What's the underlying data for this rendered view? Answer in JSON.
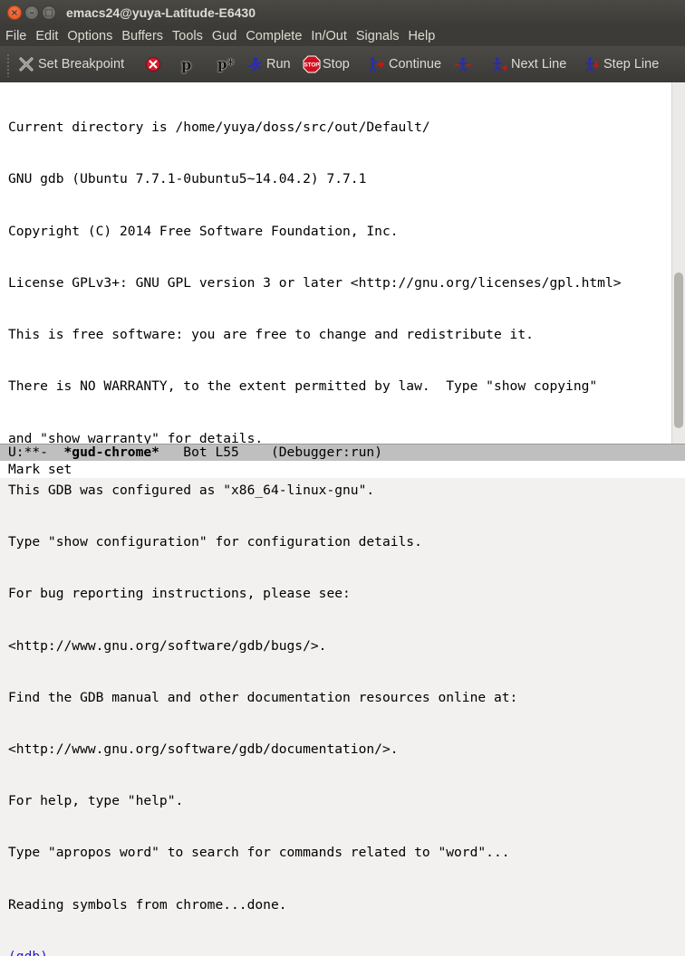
{
  "window": {
    "title": "emacs24@yuya-Latitude-E6430",
    "close_glyph": "×",
    "minimize_glyph": "–",
    "maximize_glyph": "□"
  },
  "menu": [
    "File",
    "Edit",
    "Options",
    "Buffers",
    "Tools",
    "Gud",
    "Complete",
    "In/Out",
    "Signals",
    "Help"
  ],
  "toolbar": {
    "set_breakpoint": "Set Breakpoint",
    "print_label": "p",
    "print_deref_label": "p*",
    "run": "Run",
    "stop": "Stop",
    "stop_sign_text": "STOP",
    "continue": "Continue",
    "next_line": "Next Line",
    "step_line": "Step Line"
  },
  "buffer": {
    "lines": [
      "Current directory is /home/yuya/doss/src/out/Default/",
      "GNU gdb (Ubuntu 7.7.1-0ubuntu5~14.04.2) 7.7.1",
      "Copyright (C) 2014 Free Software Foundation, Inc.",
      "License GPLv3+: GNU GPL version 3 or later <http://gnu.org/licenses/gpl.html>",
      "This is free software: you are free to change and redistribute it.",
      "There is NO WARRANTY, to the extent permitted by law.  Type \"show copying\"",
      "and \"show warranty\" for details.",
      "This GDB was configured as \"x86_64-linux-gnu\".",
      "Type \"show configuration\" for configuration details.",
      "For bug reporting instructions, please see:",
      "<http://www.gnu.org/software/gdb/bugs/>.",
      "Find the GDB manual and other documentation resources online at:",
      "<http://www.gnu.org/software/gdb/documentation/>.",
      "For help, type \"help\".",
      "Type \"apropos word\" to search for commands related to \"word\"...",
      "Reading symbols from chrome...done."
    ],
    "prompt": "(gdb)"
  },
  "modeline": {
    "status": "U:**-  ",
    "buffer_name": "*gud-chrome*",
    "position": "   Bot L55    ",
    "mode": "(Debugger:run)"
  },
  "echo_area": "Mark set",
  "colors": {
    "prompt": "#1d1dc8",
    "titlebar": "#3c3b37",
    "close_button": "#e0501e",
    "modeline_bg": "#bfbfbf"
  }
}
